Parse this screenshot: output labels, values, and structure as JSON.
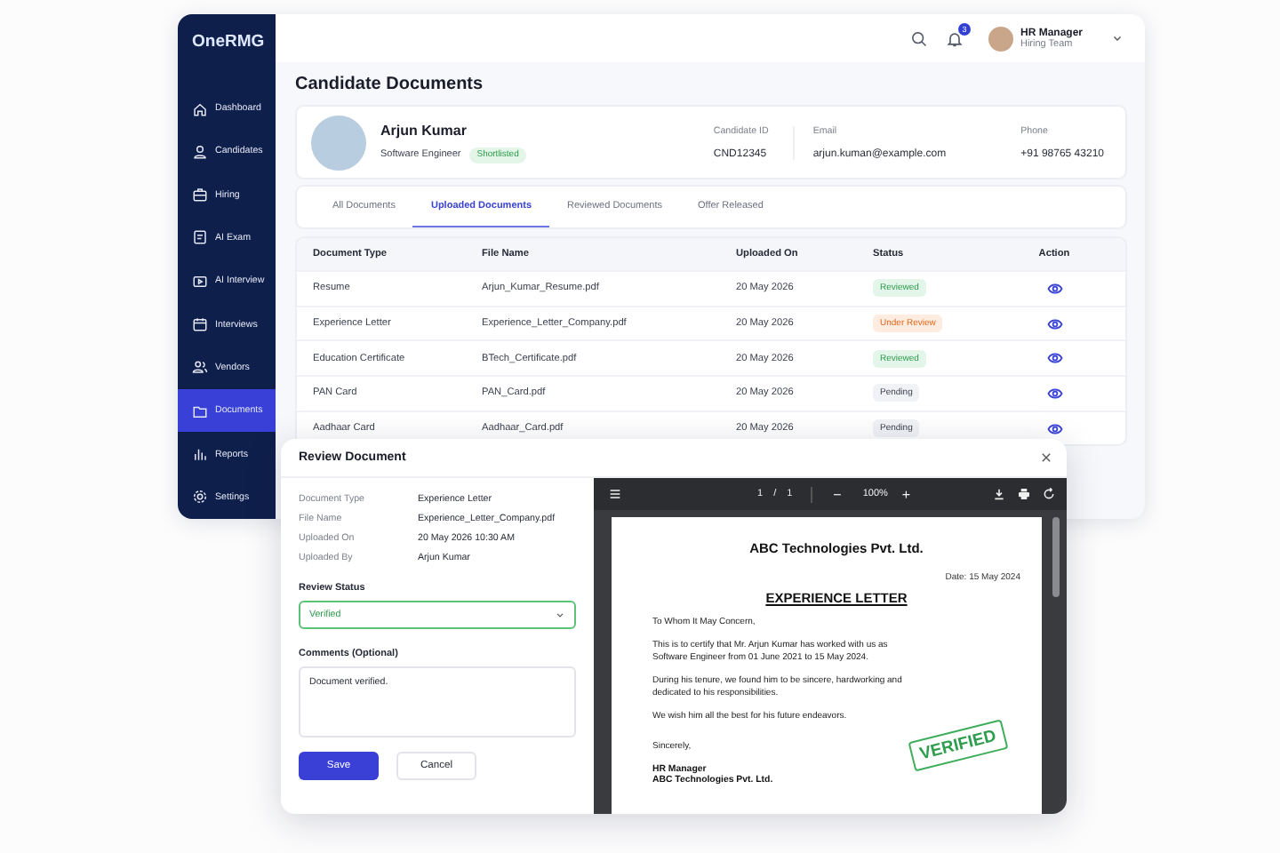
{
  "app": {
    "logo": "OneRMG"
  },
  "sidebar": {
    "items": [
      {
        "label": "Dashboard",
        "selected": false
      },
      {
        "label": "Candidates",
        "selected": false
      },
      {
        "label": "Hiring",
        "selected": false
      },
      {
        "label": "AI Exam",
        "selected": false
      },
      {
        "label": "AI Interview",
        "selected": false
      },
      {
        "label": "Interviews",
        "selected": false
      },
      {
        "label": "Vendors",
        "selected": false
      },
      {
        "label": "Documents",
        "selected": true
      },
      {
        "label": "Reports",
        "selected": false
      },
      {
        "label": "Settings",
        "selected": false
      }
    ]
  },
  "topbar": {
    "notification_count": "3",
    "user": {
      "name": "HR Manager",
      "role": "Hiring Team"
    }
  },
  "page_title": "Candidate Documents",
  "candidate": {
    "name": "Arjun Kumar",
    "title": "Software Engineer",
    "badge": "Shortlisted",
    "fields": [
      {
        "label": "Candidate ID",
        "value": "CND12345"
      },
      {
        "label": "Email",
        "value": "arjun.kuman@example.com"
      },
      {
        "label": "Phone",
        "value": "+91 98765 43210"
      }
    ]
  },
  "tabs": [
    {
      "label": "All Documents",
      "selected": false
    },
    {
      "label": "Uploaded Documents",
      "selected": true
    },
    {
      "label": "Reviewed Documents",
      "selected": false
    },
    {
      "label": "Offer Released",
      "selected": false
    }
  ],
  "table": {
    "columns": [
      "Document Type",
      "File Name",
      "Uploaded On",
      "Status",
      "Action"
    ],
    "rows": [
      {
        "type": "Resume",
        "file": "Arjun_Kumar_Resume.pdf",
        "date": "20 May 2026",
        "status": "Reviewed",
        "kind": "reviewed"
      },
      {
        "type": "Experience Letter",
        "file": "Experience_Letter_Company.pdf",
        "date": "20 May 2026",
        "status": "Under Review",
        "kind": "under_review"
      },
      {
        "type": "Education Certificate",
        "file": "BTech_Certificate.pdf",
        "date": "20 May 2026",
        "status": "Reviewed",
        "kind": "reviewed"
      },
      {
        "type": "PAN Card",
        "file": "PAN_Card.pdf",
        "date": "20 May 2026",
        "status": "Pending",
        "kind": "pending"
      },
      {
        "type": "Aadhaar Card",
        "file": "Aadhaar_Card.pdf",
        "date": "20 May 2026",
        "status": "Pending",
        "kind": "pending"
      }
    ]
  },
  "modal": {
    "title": "Review Document",
    "details": [
      {
        "label": "Document Type",
        "value": "Experience Letter"
      },
      {
        "label": "File Name",
        "value": "Experience_Letter_Company.pdf"
      },
      {
        "label": "Uploaded On",
        "value": "20 May 2026 10:30 AM"
      },
      {
        "label": "Uploaded By",
        "value": "Arjun Kumar"
      }
    ],
    "review_status": {
      "label": "Review Status",
      "value": "Verified"
    },
    "comments": {
      "label": "Comments (Optional)",
      "value": "Document verified."
    },
    "buttons": [
      {
        "label": "Save",
        "kind": "primary"
      },
      {
        "label": "Cancel",
        "kind": "secondary"
      }
    ],
    "viewer": {
      "page": "1",
      "pages": "1",
      "separator": "/",
      "zoom": "100%",
      "minus": "−",
      "plus": "+",
      "letter": {
        "company": "ABC Technologies Pvt. Ltd.",
        "date": "Date: 15 May 2024",
        "heading": "EXPERIENCE LETTER",
        "paragraphs": [
          "To Whom It May Concern,",
          "This is to certify that Mr. Arjun Kumar has worked with us as Software Engineer from 01 June 2021 to 15 May 2024.",
          "During his tenure, we found him to be sincere, hardworking and dedicated to his responsibilities.",
          "We wish him all the best for his future endeavors."
        ],
        "closing": "Sincerely,",
        "signer": "HR Manager",
        "signer_company": "ABC Technologies Pvt. Ltd.",
        "stamp": "VERIFIED"
      }
    }
  }
}
